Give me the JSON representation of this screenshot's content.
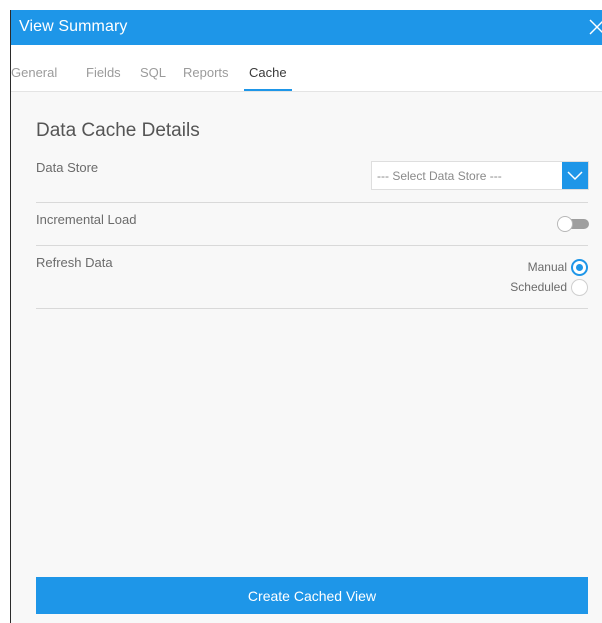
{
  "dialog": {
    "title": "View Summary",
    "close_icon": "close-icon"
  },
  "tabs": [
    {
      "label": "General",
      "active": false
    },
    {
      "label": "Fields",
      "active": false
    },
    {
      "label": "SQL",
      "active": false
    },
    {
      "label": "Reports",
      "active": false
    },
    {
      "label": "Cache",
      "active": true
    }
  ],
  "cache": {
    "section_title": "Data Cache Details",
    "data_store": {
      "label": "Data Store",
      "selected": "--- Select Data Store ---"
    },
    "incremental_load": {
      "label": "Incremental Load",
      "enabled": false
    },
    "refresh_data": {
      "label": "Refresh Data",
      "options": [
        {
          "label": "Manual",
          "checked": true
        },
        {
          "label": "Scheduled",
          "checked": false
        }
      ]
    }
  },
  "actions": {
    "create_label": "Create Cached View"
  },
  "colors": {
    "accent": "#1e96e8",
    "background": "#f8f8f8"
  }
}
